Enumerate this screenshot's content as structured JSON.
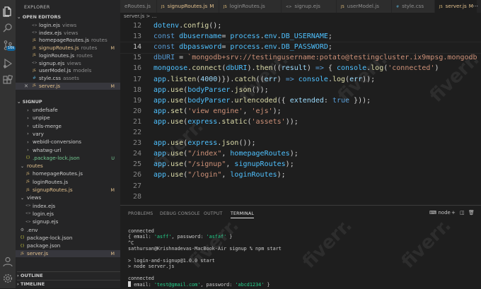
{
  "activity_bar": {
    "icons": [
      "files-icon",
      "search-icon",
      "source-control-icon",
      "run-debug-icon",
      "extensions-icon",
      "account-icon",
      "settings-gear-icon"
    ],
    "badge": "16k"
  },
  "sidebar": {
    "title": "EXPLORER",
    "open_editors_title": "OPEN EDITORS",
    "open_editors": [
      {
        "name": "login.ejs",
        "hint": "views",
        "color": "#cccccc",
        "badge": ""
      },
      {
        "name": "index.ejs",
        "hint": "views",
        "color": "#cccccc",
        "badge": ""
      },
      {
        "name": "homepageRoutes.js",
        "hint": "routes",
        "color": "#cccccc",
        "badge": ""
      },
      {
        "name": "signupRoutes.js",
        "hint": "routes",
        "color": "#e2c08d",
        "badge": "M"
      },
      {
        "name": "loginRoutes.js",
        "hint": "routes",
        "color": "#cccccc",
        "badge": ""
      },
      {
        "name": "signup.ejs",
        "hint": "views",
        "color": "#cccccc",
        "badge": ""
      },
      {
        "name": "userModel.js",
        "hint": "models",
        "color": "#cccccc",
        "badge": ""
      },
      {
        "name": "style.css",
        "hint": "assets",
        "color": "#cccccc",
        "badge": ""
      },
      {
        "name": "server.js",
        "hint": "",
        "color": "#e2c08d",
        "badge": "M"
      }
    ],
    "project_title": "SIGNUP",
    "tree": [
      {
        "name": "undefsafe",
        "type": "folder",
        "indent": 1,
        "color": "#cccccc",
        "badge": ""
      },
      {
        "name": "unpipe",
        "type": "folder",
        "indent": 1,
        "color": "#cccccc",
        "badge": ""
      },
      {
        "name": "utils-merge",
        "type": "folder",
        "indent": 1,
        "color": "#cccccc",
        "badge": ""
      },
      {
        "name": "vary",
        "type": "folder",
        "indent": 1,
        "color": "#cccccc",
        "badge": ""
      },
      {
        "name": "webidl-conversions",
        "type": "folder",
        "indent": 1,
        "color": "#cccccc",
        "badge": ""
      },
      {
        "name": "whatwg-url",
        "type": "folder",
        "indent": 1,
        "color": "#cccccc",
        "badge": ""
      },
      {
        "name": ".package-lock.json",
        "type": "json",
        "indent": 1,
        "color": "#73c991",
        "badge": "U"
      },
      {
        "name": "routes",
        "type": "folder-open",
        "indent": 0,
        "color": "#e2c08d",
        "badge": ""
      },
      {
        "name": "homepageRoutes.js",
        "type": "js",
        "indent": 1,
        "color": "#cccccc",
        "badge": ""
      },
      {
        "name": "loginRoutes.js",
        "type": "js",
        "indent": 1,
        "color": "#cccccc",
        "badge": ""
      },
      {
        "name": "signupRoutes.js",
        "type": "js",
        "indent": 1,
        "color": "#e2c08d",
        "badge": "M"
      },
      {
        "name": "views",
        "type": "folder-open",
        "indent": 0,
        "color": "#cccccc",
        "badge": ""
      },
      {
        "name": "index.ejs",
        "type": "ejs",
        "indent": 1,
        "color": "#cccccc",
        "badge": ""
      },
      {
        "name": "login.ejs",
        "type": "ejs",
        "indent": 1,
        "color": "#cccccc",
        "badge": ""
      },
      {
        "name": "signup.ejs",
        "type": "ejs",
        "indent": 1,
        "color": "#cccccc",
        "badge": ""
      },
      {
        "name": ".env",
        "type": "gear",
        "indent": 0,
        "color": "#cccccc",
        "badge": ""
      },
      {
        "name": "package-lock.json",
        "type": "json",
        "indent": 0,
        "color": "#cccccc",
        "badge": ""
      },
      {
        "name": "package.json",
        "type": "json",
        "indent": 0,
        "color": "#cccccc",
        "badge": ""
      },
      {
        "name": "server.js",
        "type": "js",
        "indent": 0,
        "color": "#e2c08d",
        "badge": "M"
      }
    ],
    "outline_title": "OUTLINE",
    "timeline_title": "TIMELINE"
  },
  "tabs": [
    {
      "label": "eRoutes.js",
      "modified": "",
      "active": false,
      "icon": ""
    },
    {
      "label": "signupRoutes.js",
      "modified": "M",
      "active": false,
      "icon": "JS"
    },
    {
      "label": "loginRoutes.js",
      "modified": "",
      "active": false,
      "icon": "JS"
    },
    {
      "label": "signup.ejs",
      "modified": "",
      "active": false,
      "icon": "<>"
    },
    {
      "label": "userModel.js",
      "modified": "",
      "active": false,
      "icon": "JS"
    },
    {
      "label": "style.css",
      "modified": "",
      "active": false,
      "icon": "#"
    },
    {
      "label": "server.js",
      "modified": "M",
      "active": true,
      "icon": "JS"
    }
  ],
  "breadcrumb": "server.js > ...",
  "editor": {
    "current_line": 14,
    "lines": [
      {
        "n": 12,
        "html": "<span class='v'>dotenv</span>.<span class='f'>config</span>();"
      },
      {
        "n": 13,
        "html": "<span class='k'>const</span> <span class='v'>dbusername</span>= <span class='v'>process</span>.<span class='v'>env</span>.<span class='v'>DB_USERNAME</span>;"
      },
      {
        "n": 14,
        "html": "<span class='k'>const</span> <span class='v'>dbpassword</span>= <span class='v'>process</span>.<span class='v'>env</span>.<span class='v'>DB_PASSWORD</span>;"
      },
      {
        "n": 15,
        "html": "<span class='k'>dbURI</span> = <span class='s'>`mongodb+srv://testingusername:potato@testingcluster.ix9mpsg.mongodb</span>"
      },
      {
        "n": 16,
        "html": "<span class='v'>mongoose</span>.<span class='f'>connect</span>(<span class='v'>dbURI</span>).<span class='f'>then</span>((<span class='p'>result</span>) <span class='k'>=&gt;</span> { <span class='v'>console</span>.<span class='f'>log</span>(<span class='s'>'connected'</span>)"
      },
      {
        "n": 17,
        "html": "<span class='v'>app</span>.<span class='f'>listen</span>(<span class='p'>4000</span>)}).<span class='f'>catch</span>((<span class='p'>err</span>) <span class='k'>=&gt;</span> <span class='v'>console</span>.<span class='f'>log</span>(<span class='p'>err</span>));"
      },
      {
        "n": 18,
        "html": "<span class='v'>app</span>.<span class='f'>use</span>(<span class='v'>bodyParser</span>.<span class='f'>json</span>());"
      },
      {
        "n": 19,
        "html": "<span class='v'>app</span>.<span class='f'>use</span>(<span class='v'>bodyParser</span>.<span class='f'>urlencoded</span>({ <span class='p'>extended</span>: <span class='k'>true</span> }));"
      },
      {
        "n": 20,
        "html": "<span class='v'>app</span>.<span class='f'>set</span>(<span class='s'>'view engine'</span>, <span class='s'>'ejs'</span>);"
      },
      {
        "n": 21,
        "html": "<span class='v'>app</span>.<span class='f'>use</span>(<span class='v'>express</span>.<span class='f'>static</span>(<span class='s'>'assets'</span>));"
      },
      {
        "n": 22,
        "html": ""
      },
      {
        "n": 23,
        "html": "<span class='v'>app</span>.<span class='f'>use</span>(<span class='v'>express</span>.<span class='f'>json</span>());"
      },
      {
        "n": 24,
        "html": "<span class='v'>app</span>.<span class='f'>use</span>(<span class='s'>\"/index\"</span>, <span class='v'>homepageRoutes</span>);"
      },
      {
        "n": 25,
        "html": "<span class='v'>app</span>.<span class='f'>use</span>(<span class='s'>\"/signup\"</span>, <span class='v'>signupRoutes</span>);"
      },
      {
        "n": 26,
        "html": "<span class='v'>app</span>.<span class='f'>use</span>(<span class='s'>\"/login\"</span>, <span class='v'>loginRoutes</span>);"
      },
      {
        "n": 27,
        "html": ""
      },
      {
        "n": 28,
        "html": ""
      }
    ]
  },
  "panel": {
    "tabs": [
      {
        "label": "PROBLEMS",
        "active": false
      },
      {
        "label": "DEBUG CONSOLE",
        "active": false
      },
      {
        "label": "OUTPUT",
        "active": false
      },
      {
        "label": "TERMINAL",
        "active": true
      }
    ],
    "shell": "node",
    "terminal_lines": [
      "connected",
      "{ email: <span class='tstr'>'asff'</span>, password: <span class='tstr'>'asfaf'</span> }",
      "^C",
      "sathursan@Krishnadevas-MacBook-Air signup % npm start",
      "",
      "&gt; login-and-signup@1.0.0 start",
      "&gt; node server.js",
      "",
      "connected",
      "{ email: <span class='tstr'>'test@gmail.com'</span>, password: <span class='tstr'>'abcd1234'</span> }"
    ]
  },
  "watermark": "fiverr."
}
